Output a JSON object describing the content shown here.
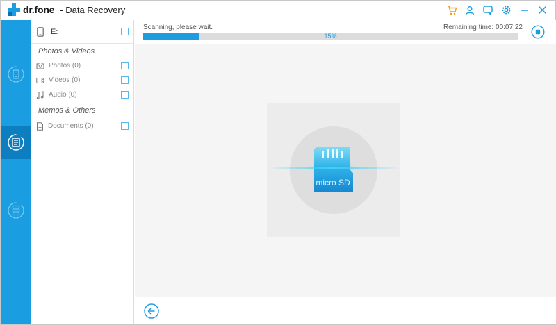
{
  "window": {
    "brand": "dr.fone",
    "app_title": "- Data Recovery",
    "accent_color": "#1a9de1"
  },
  "title_actions": [
    {
      "icon": "cart-icon"
    },
    {
      "icon": "user-icon"
    },
    {
      "icon": "feedback-icon"
    },
    {
      "icon": "settings-icon"
    },
    {
      "icon": "minimize-icon"
    },
    {
      "icon": "close-icon"
    }
  ],
  "rail": {
    "items": [
      {
        "icon": "phone-recover-icon",
        "active": false
      },
      {
        "icon": "storage-recover-icon",
        "active": true
      },
      {
        "icon": "drive-recover-icon",
        "active": false
      }
    ]
  },
  "categories": {
    "drive_label": "E:",
    "sections": [
      {
        "title": "Photos & Videos",
        "items": [
          {
            "label": "Photos (0)",
            "icon": "camera-icon"
          },
          {
            "label": "Videos (0)",
            "icon": "video-icon"
          },
          {
            "label": "Audio (0)",
            "icon": "music-icon"
          }
        ]
      },
      {
        "title": "Memos & Others",
        "items": [
          {
            "label": "Documents (0)",
            "icon": "document-icon"
          }
        ]
      }
    ]
  },
  "scan": {
    "status": "Scanning, please wait.",
    "remaining": "Remaining time: 00:07:22",
    "progress_percent": 15,
    "progress_text": "15%"
  },
  "illustration": {
    "card_text": "micro SD",
    "icon": "microsd-card-icon"
  },
  "bottom": {
    "back_icon": "back-arrow-icon"
  }
}
